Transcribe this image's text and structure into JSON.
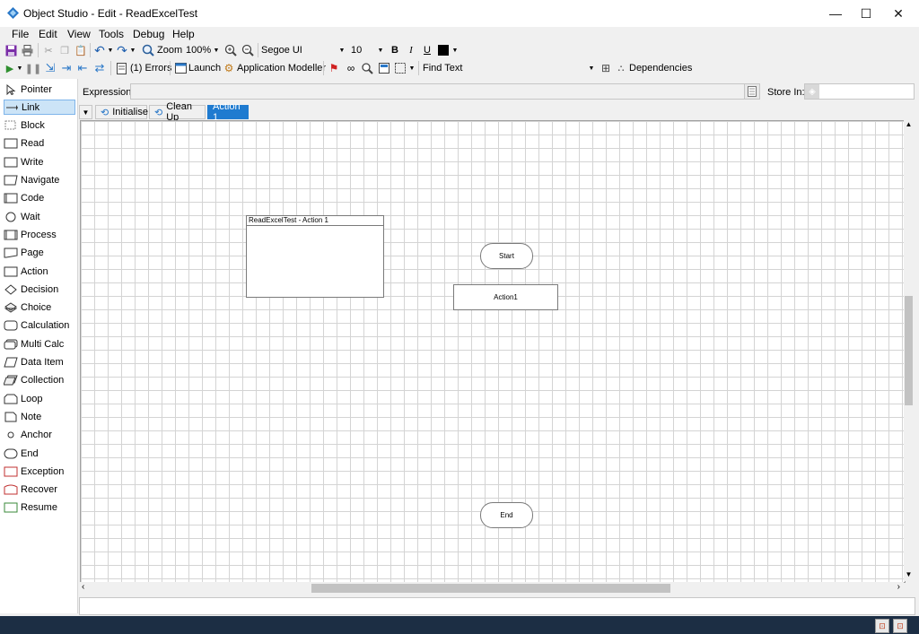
{
  "window": {
    "title": "Object Studio  - Edit - ReadExcelTest",
    "controls": {
      "minimize": "—",
      "maximize": "☐",
      "close": "✕"
    }
  },
  "menu": [
    "File",
    "Edit",
    "View",
    "Tools",
    "Debug",
    "Help"
  ],
  "toolbar1": {
    "zoom_label": "Zoom",
    "zoom_value": "100%",
    "font_name": "Segoe UI",
    "font_size": "10",
    "bold": "B",
    "italic": "I",
    "underline": "U"
  },
  "toolbar2": {
    "errors": "(1) Errors",
    "launch": "Launch",
    "app_modeller": "Application Modeller",
    "find_text": "Find Text",
    "dependencies": "Dependencies"
  },
  "palette": [
    {
      "label": "Pointer",
      "icon": "pointer-icon"
    },
    {
      "label": "Link",
      "icon": "link-icon"
    },
    {
      "label": "Block",
      "icon": "block-icon"
    },
    {
      "label": "Read",
      "icon": "read-icon"
    },
    {
      "label": "Write",
      "icon": "write-icon"
    },
    {
      "label": "Navigate",
      "icon": "navigate-icon"
    },
    {
      "label": "Code",
      "icon": "code-icon"
    },
    {
      "label": "Wait",
      "icon": "wait-icon"
    },
    {
      "label": "Process",
      "icon": "process-icon"
    },
    {
      "label": "Page",
      "icon": "page-icon"
    },
    {
      "label": "Action",
      "icon": "action-icon"
    },
    {
      "label": "Decision",
      "icon": "decision-icon"
    },
    {
      "label": "Choice",
      "icon": "choice-icon"
    },
    {
      "label": "Calculation",
      "icon": "calculation-icon"
    },
    {
      "label": "Multi Calc",
      "icon": "multi-calc-icon"
    },
    {
      "label": "Data Item",
      "icon": "data-item-icon"
    },
    {
      "label": "Collection",
      "icon": "collection-icon"
    },
    {
      "label": "Loop",
      "icon": "loop-icon"
    },
    {
      "label": "Note",
      "icon": "note-icon"
    },
    {
      "label": "Anchor",
      "icon": "anchor-icon"
    },
    {
      "label": "End",
      "icon": "end-icon"
    },
    {
      "label": "Exception",
      "icon": "exception-icon"
    },
    {
      "label": "Recover",
      "icon": "recover-icon"
    },
    {
      "label": "Resume",
      "icon": "resume-icon"
    }
  ],
  "palette_selected": "Link",
  "expression": {
    "label": "Expression:",
    "value": ""
  },
  "store_in": {
    "label": "Store In:",
    "value": ""
  },
  "tabs": [
    {
      "label": "Initialise",
      "active": false
    },
    {
      "label": "Clean Up",
      "active": false
    },
    {
      "label": "Action 1",
      "active": true
    }
  ],
  "canvas": {
    "info_box_title": "ReadExcelTest - Action 1",
    "start": "Start",
    "action": "Action1",
    "end": "End"
  },
  "colors": {
    "accent": "#1f7bd0",
    "taskbar": "#1c2e44",
    "grid": "#d4d4d4"
  }
}
